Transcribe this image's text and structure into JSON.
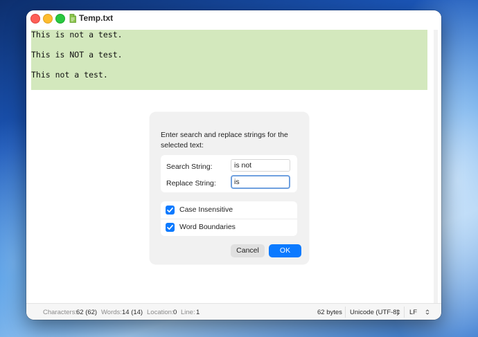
{
  "window": {
    "title": "Temp.txt",
    "file_icon": "text-document-icon"
  },
  "editor": {
    "lines": [
      "This is not a test.",
      "This is NOT a test.",
      "This not a test."
    ],
    "highlight_color": "#d3e8bd"
  },
  "dialog": {
    "prompt": "Enter search and replace strings for the selected text:",
    "search_label": "Search String:",
    "search_value": "is not",
    "replace_label": "Replace String:",
    "replace_value": "is",
    "case_insensitive_label": "Case Insensitive",
    "case_insensitive_checked": true,
    "word_boundaries_label": "Word Boundaries",
    "word_boundaries_checked": true,
    "cancel_label": "Cancel",
    "ok_label": "OK",
    "accent_color": "#0b7aff"
  },
  "status": {
    "characters_label": "Characters:",
    "characters_value": "62 (62)",
    "words_label": "Words:",
    "words_value": "14 (14)",
    "location_label": "Location:",
    "location_value": "0",
    "line_label": "Line:",
    "line_value": "1",
    "size": "62 bytes",
    "encoding": "Unicode (UTF-8)",
    "line_ending": "LF"
  }
}
